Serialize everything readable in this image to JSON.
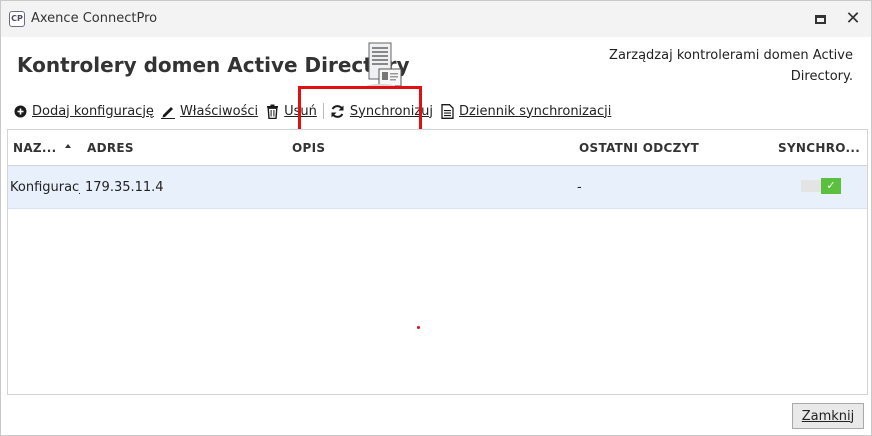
{
  "window": {
    "app_icon_text": "CP",
    "title": "Axence ConnectPro"
  },
  "header": {
    "title": "Kontrolery domen Active Directory",
    "description": "Zarządzaj kontrolerami domen Active Directory."
  },
  "toolbar": {
    "add_label": "Dodaj konfigurację",
    "properties_label": "Właściwości",
    "delete_label": "Usuń",
    "sync_label": "Synchronizuj",
    "log_label": "Dziennik synchronizacji"
  },
  "table": {
    "columns": [
      "NAZ...",
      "ADRES",
      "OPIS",
      "OSTATNI ODCZYT",
      "SYNCHRO..."
    ],
    "rows": [
      {
        "name": "Konfiguracja",
        "address": "179.35.11.4",
        "description": "",
        "last_read": "-",
        "sync_enabled": true
      }
    ]
  },
  "footer": {
    "close_label": "Zamknij"
  },
  "colors": {
    "highlight": "#e01010",
    "toggle_on": "#5bbf3f",
    "selected_row": "#e8f0fb"
  }
}
